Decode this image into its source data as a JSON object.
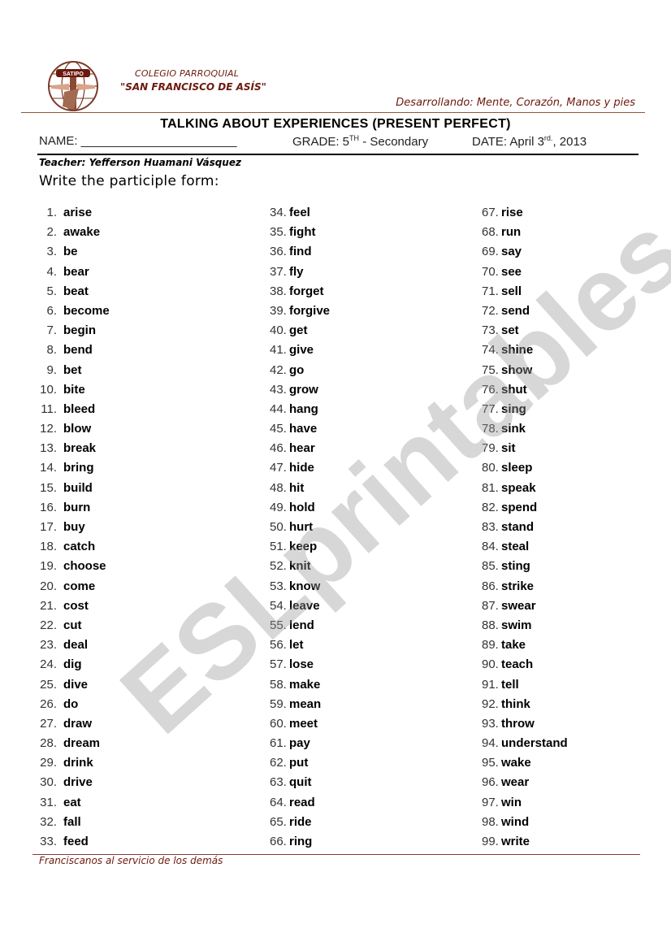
{
  "header": {
    "logo_text": "SATIPO",
    "school_line1": "COLEGIO PARROQUIAL",
    "school_line2": "\"SAN FRANCISCO DE ASÍS\"",
    "motto": "Desarrollando: Mente, Corazón, Manos y pies"
  },
  "title": "TALKING ABOUT EXPERIENCES (PRESENT PERFECT)",
  "info": {
    "name_label": "NAME: _______________________",
    "grade_label": "GRADE: 5",
    "grade_sup": "TH",
    "grade_rest": " - Secondary",
    "date_label": "DATE: April 3",
    "date_sup": "rd.",
    "date_rest": ", 2013"
  },
  "teacher": "Teacher: Yefferson Huamani Vásquez",
  "instruction": "Write the participle form:",
  "verbs": [
    [
      "1.",
      "arise"
    ],
    [
      "2.",
      "awake"
    ],
    [
      "3.",
      "be"
    ],
    [
      "4.",
      "bear"
    ],
    [
      "5.",
      "beat"
    ],
    [
      "6.",
      "become"
    ],
    [
      "7.",
      "begin"
    ],
    [
      "8.",
      "bend"
    ],
    [
      "9.",
      "bet"
    ],
    [
      "10.",
      "bite"
    ],
    [
      "11.",
      "bleed"
    ],
    [
      "12.",
      "blow"
    ],
    [
      "13.",
      "break"
    ],
    [
      "14.",
      "bring"
    ],
    [
      "15.",
      "build"
    ],
    [
      "16.",
      "burn"
    ],
    [
      "17.",
      "buy"
    ],
    [
      "18.",
      "catch"
    ],
    [
      "19.",
      "choose"
    ],
    [
      "20.",
      "come"
    ],
    [
      "21.",
      "cost"
    ],
    [
      "22.",
      "cut"
    ],
    [
      "23.",
      "deal"
    ],
    [
      "24.",
      "dig"
    ],
    [
      "25.",
      "dive"
    ],
    [
      "26.",
      "do"
    ],
    [
      "27.",
      "draw"
    ],
    [
      "28.",
      "dream"
    ],
    [
      "29.",
      "drink"
    ],
    [
      "30.",
      "drive"
    ],
    [
      "31.",
      "eat"
    ],
    [
      "32.",
      "fall"
    ],
    [
      "33.",
      "feed"
    ],
    [
      "34.",
      "feel"
    ],
    [
      "35.",
      "fight"
    ],
    [
      "36.",
      "find"
    ],
    [
      "37.",
      "fly"
    ],
    [
      "38.",
      "forget"
    ],
    [
      "39.",
      "forgive"
    ],
    [
      "40.",
      "get"
    ],
    [
      "41.",
      "give"
    ],
    [
      "42.",
      "go"
    ],
    [
      "43.",
      "grow"
    ],
    [
      "44.",
      "hang"
    ],
    [
      "45.",
      "have"
    ],
    [
      "46.",
      "hear"
    ],
    [
      "47.",
      "hide"
    ],
    [
      "48.",
      "hit"
    ],
    [
      "49.",
      "hold"
    ],
    [
      "50.",
      "hurt"
    ],
    [
      "51.",
      "keep"
    ],
    [
      "52.",
      "knit"
    ],
    [
      "53.",
      "know"
    ],
    [
      "54.",
      "leave"
    ],
    [
      "55.",
      "lend"
    ],
    [
      "56.",
      "let"
    ],
    [
      "57.",
      "lose"
    ],
    [
      "58.",
      "make"
    ],
    [
      "59.",
      "mean"
    ],
    [
      "60.",
      "meet"
    ],
    [
      "61.",
      "pay"
    ],
    [
      "62.",
      "put"
    ],
    [
      "63.",
      "quit"
    ],
    [
      "64.",
      "read"
    ],
    [
      "65.",
      "ride"
    ],
    [
      "66.",
      "ring"
    ],
    [
      "67.",
      "rise"
    ],
    [
      "68.",
      "run"
    ],
    [
      "69.",
      "say"
    ],
    [
      "70.",
      "see"
    ],
    [
      "71.",
      "sell"
    ],
    [
      "72.",
      "send"
    ],
    [
      "73.",
      "set"
    ],
    [
      "74.",
      "shine"
    ],
    [
      "75.",
      "show"
    ],
    [
      "76.",
      "shut"
    ],
    [
      "77.",
      "sing"
    ],
    [
      "78.",
      "sink"
    ],
    [
      "79.",
      "sit"
    ],
    [
      "80.",
      "sleep"
    ],
    [
      "81.",
      "speak"
    ],
    [
      "82.",
      "spend"
    ],
    [
      "83.",
      "stand"
    ],
    [
      "84.",
      "steal"
    ],
    [
      "85.",
      "sting"
    ],
    [
      "86.",
      "strike"
    ],
    [
      "87.",
      "swear"
    ],
    [
      "88.",
      "swim"
    ],
    [
      "89.",
      "take"
    ],
    [
      "90.",
      "teach"
    ],
    [
      "91.",
      "tell"
    ],
    [
      "92.",
      "think"
    ],
    [
      "93.",
      "throw"
    ],
    [
      "94.",
      "understand"
    ],
    [
      "95.",
      "wake"
    ],
    [
      "96.",
      "wear"
    ],
    [
      "97.",
      "win"
    ],
    [
      "98.",
      "wind"
    ],
    [
      "99.",
      "write"
    ]
  ],
  "footer": "Franciscanos al servicio de los demás",
  "watermark": "ESLprintables.com",
  "colors": {
    "brand_brown": "#6b1a0e",
    "rule_brown": "#8a5a3a"
  }
}
